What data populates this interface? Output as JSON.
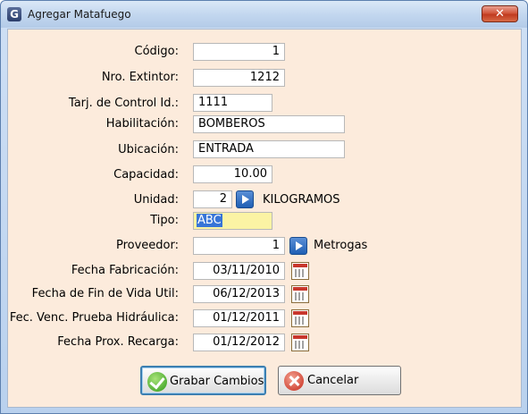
{
  "window": {
    "title": "Agregar Matafuego",
    "app_icon": "G",
    "close_symbol": "✕"
  },
  "form": {
    "codigo": {
      "label": "Código:",
      "value": "1"
    },
    "nro_extintor": {
      "label": "Nro. Extintor:",
      "value": "1212"
    },
    "tarj_control": {
      "label": "Tarj. de Control Id.:",
      "value": "1111"
    },
    "habilitacion": {
      "label": "Habilitación:",
      "value": "BOMBEROS"
    },
    "ubicacion": {
      "label": "Ubicación:",
      "value": "ENTRADA"
    },
    "capacidad": {
      "label": "Capacidad:",
      "value": "10.00"
    },
    "unidad": {
      "label": "Unidad:",
      "value": "2",
      "description": "KILOGRAMOS"
    },
    "tipo": {
      "label": "Tipo:",
      "value": "ABC"
    },
    "proveedor": {
      "label": "Proveedor:",
      "value": "1",
      "description": "Metrogas"
    },
    "fecha_fabricacion": {
      "label": "Fecha Fabricación:",
      "value": "03/11/2010"
    },
    "fecha_fin_vida": {
      "label": "Fecha de Fin de Vida Util:",
      "value": "06/12/2013"
    },
    "fec_venc_prueba": {
      "label": "Fec. Venc. Prueba Hidráulica:",
      "value": "01/12/2011"
    },
    "fecha_prox_recarga": {
      "label": "Fecha Prox. Recarga:",
      "value": "01/12/2012"
    }
  },
  "buttons": {
    "save_label": "Grabar Cambios",
    "cancel_label": "Cancelar"
  },
  "icons": {
    "lookup": "arrow-right-icon",
    "calendar": "calendar-icon",
    "save": "checkmark-icon",
    "cancel": "cancel-icon"
  }
}
